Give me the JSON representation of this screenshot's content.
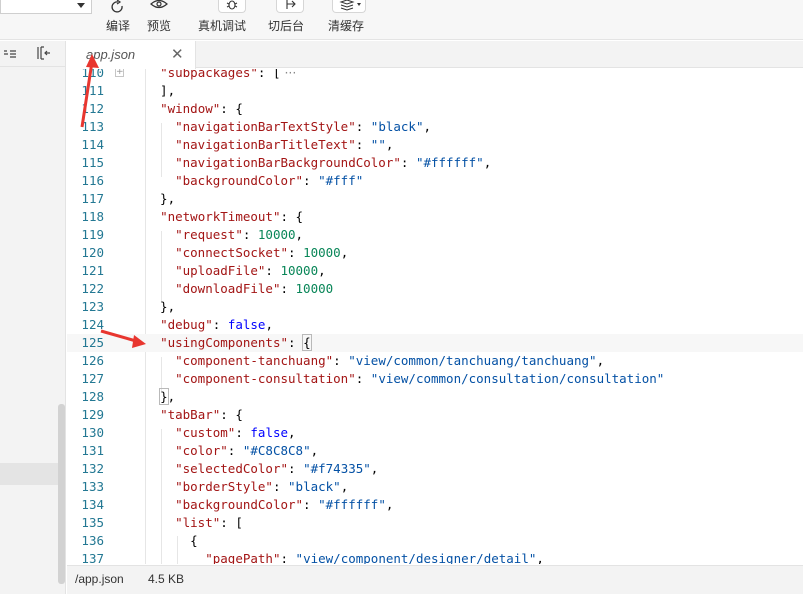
{
  "toolbar": {
    "buttons": [
      {
        "label": "编译",
        "icon": "refresh-icon"
      },
      {
        "label": "预览",
        "icon": "eye-icon"
      },
      {
        "label": "真机调试",
        "icon": "bug-icon"
      },
      {
        "label": "切后台",
        "icon": "switch-background-icon"
      },
      {
        "label": "清缓存",
        "icon": "layers-icon"
      }
    ]
  },
  "left_panel": {
    "icons": [
      "sort-icon",
      "collapse-panel-icon"
    ]
  },
  "tab": {
    "label": "app.json"
  },
  "editor": {
    "lines": [
      {
        "n": "110",
        "tokens": [
          [
            "p",
            "  "
          ],
          [
            "k",
            "\"subpackages\""
          ],
          [
            "p",
            ": ["
          ]
        ],
        "folded": true
      },
      {
        "n": "111",
        "tokens": [
          [
            "p",
            "  ],"
          ]
        ]
      },
      {
        "n": "112",
        "tokens": [
          [
            "p",
            "  "
          ],
          [
            "k",
            "\"window\""
          ],
          [
            "p",
            ": {"
          ]
        ]
      },
      {
        "n": "113",
        "tokens": [
          [
            "p",
            "    "
          ],
          [
            "k",
            "\"navigationBarTextStyle\""
          ],
          [
            "p",
            ": "
          ],
          [
            "s",
            "\"black\""
          ],
          [
            "p",
            ","
          ]
        ]
      },
      {
        "n": "114",
        "tokens": [
          [
            "p",
            "    "
          ],
          [
            "k",
            "\"navigationBarTitleText\""
          ],
          [
            "p",
            ": "
          ],
          [
            "s",
            "\"\""
          ],
          [
            "p",
            ","
          ]
        ]
      },
      {
        "n": "115",
        "tokens": [
          [
            "p",
            "    "
          ],
          [
            "k",
            "\"navigationBarBackgroundColor\""
          ],
          [
            "p",
            ": "
          ],
          [
            "s",
            "\"#ffffff\""
          ],
          [
            "p",
            ","
          ]
        ]
      },
      {
        "n": "116",
        "tokens": [
          [
            "p",
            "    "
          ],
          [
            "k",
            "\"backgroundColor\""
          ],
          [
            "p",
            ": "
          ],
          [
            "s",
            "\"#fff\""
          ]
        ]
      },
      {
        "n": "117",
        "tokens": [
          [
            "p",
            "  },"
          ]
        ]
      },
      {
        "n": "118",
        "tokens": [
          [
            "p",
            "  "
          ],
          [
            "k",
            "\"networkTimeout\""
          ],
          [
            "p",
            ": {"
          ]
        ]
      },
      {
        "n": "119",
        "tokens": [
          [
            "p",
            "    "
          ],
          [
            "k",
            "\"request\""
          ],
          [
            "p",
            ": "
          ],
          [
            "n",
            "10000"
          ],
          [
            "p",
            ","
          ]
        ]
      },
      {
        "n": "120",
        "tokens": [
          [
            "p",
            "    "
          ],
          [
            "k",
            "\"connectSocket\""
          ],
          [
            "p",
            ": "
          ],
          [
            "n",
            "10000"
          ],
          [
            "p",
            ","
          ]
        ]
      },
      {
        "n": "121",
        "tokens": [
          [
            "p",
            "    "
          ],
          [
            "k",
            "\"uploadFile\""
          ],
          [
            "p",
            ": "
          ],
          [
            "n",
            "10000"
          ],
          [
            "p",
            ","
          ]
        ]
      },
      {
        "n": "122",
        "tokens": [
          [
            "p",
            "    "
          ],
          [
            "k",
            "\"downloadFile\""
          ],
          [
            "p",
            ": "
          ],
          [
            "n",
            "10000"
          ]
        ]
      },
      {
        "n": "123",
        "tokens": [
          [
            "p",
            "  },"
          ]
        ]
      },
      {
        "n": "124",
        "tokens": [
          [
            "p",
            "  "
          ],
          [
            "k",
            "\"debug\""
          ],
          [
            "p",
            ": "
          ],
          [
            "kw",
            "false"
          ],
          [
            "p",
            ","
          ]
        ]
      },
      {
        "n": "125",
        "tokens": [
          [
            "p",
            "  "
          ],
          [
            "k",
            "\"usingComponents\""
          ],
          [
            "p",
            ": "
          ],
          [
            "bm",
            "{"
          ]
        ],
        "active": true
      },
      {
        "n": "126",
        "tokens": [
          [
            "p",
            "    "
          ],
          [
            "k",
            "\"component-tanchuang\""
          ],
          [
            "p",
            ": "
          ],
          [
            "s",
            "\"view/common/tanchuang/tanchuang\""
          ],
          [
            "p",
            ","
          ]
        ]
      },
      {
        "n": "127",
        "tokens": [
          [
            "p",
            "    "
          ],
          [
            "k",
            "\"component-consultation\""
          ],
          [
            "p",
            ": "
          ],
          [
            "s",
            "\"view/common/consultation/consultation\""
          ]
        ]
      },
      {
        "n": "128",
        "tokens": [
          [
            "p",
            "  "
          ],
          [
            "bm",
            "}"
          ],
          [
            "p",
            ","
          ]
        ]
      },
      {
        "n": "129",
        "tokens": [
          [
            "p",
            "  "
          ],
          [
            "k",
            "\"tabBar\""
          ],
          [
            "p",
            ": {"
          ]
        ]
      },
      {
        "n": "130",
        "tokens": [
          [
            "p",
            "    "
          ],
          [
            "k",
            "\"custom\""
          ],
          [
            "p",
            ": "
          ],
          [
            "kw",
            "false"
          ],
          [
            "p",
            ","
          ]
        ]
      },
      {
        "n": "131",
        "tokens": [
          [
            "p",
            "    "
          ],
          [
            "k",
            "\"color\""
          ],
          [
            "p",
            ": "
          ],
          [
            "s",
            "\"#C8C8C8\""
          ],
          [
            "p",
            ","
          ]
        ]
      },
      {
        "n": "132",
        "tokens": [
          [
            "p",
            "    "
          ],
          [
            "k",
            "\"selectedColor\""
          ],
          [
            "p",
            ": "
          ],
          [
            "s",
            "\"#f74335\""
          ],
          [
            "p",
            ","
          ]
        ]
      },
      {
        "n": "133",
        "tokens": [
          [
            "p",
            "    "
          ],
          [
            "k",
            "\"borderStyle\""
          ],
          [
            "p",
            ": "
          ],
          [
            "s",
            "\"black\""
          ],
          [
            "p",
            ","
          ]
        ]
      },
      {
        "n": "134",
        "tokens": [
          [
            "p",
            "    "
          ],
          [
            "k",
            "\"backgroundColor\""
          ],
          [
            "p",
            ": "
          ],
          [
            "s",
            "\"#ffffff\""
          ],
          [
            "p",
            ","
          ]
        ]
      },
      {
        "n": "135",
        "tokens": [
          [
            "p",
            "    "
          ],
          [
            "k",
            "\"list\""
          ],
          [
            "p",
            ": ["
          ]
        ]
      },
      {
        "n": "136",
        "tokens": [
          [
            "p",
            "      {"
          ]
        ]
      },
      {
        "n": "137",
        "tokens": [
          [
            "p",
            "        "
          ],
          [
            "k",
            "\"pagePath\""
          ],
          [
            "p",
            ": "
          ],
          [
            "s",
            "\"view/component/designer/detail\""
          ],
          [
            "p",
            ","
          ]
        ]
      }
    ]
  },
  "statusbar": {
    "path": "/app.json",
    "size": "4.5 KB"
  },
  "colors": {
    "annotation_arrow": "#e8362f",
    "json_key": "#a31515",
    "json_string": "#0451a5",
    "json_number": "#098658",
    "json_keyword": "#0000ff",
    "line_number": "#237893"
  }
}
